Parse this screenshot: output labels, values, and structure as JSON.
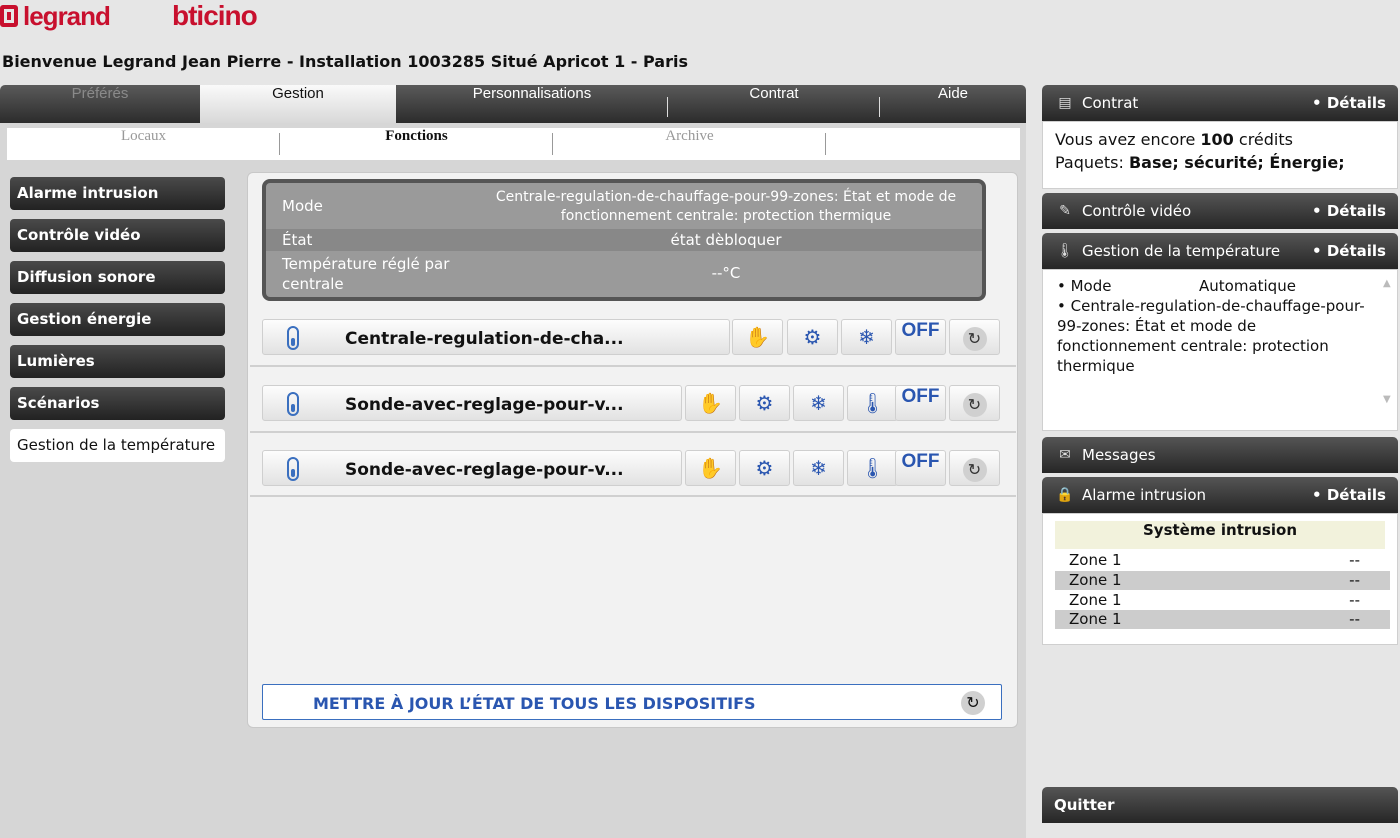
{
  "brand": {
    "legrand": "legrand",
    "bticino": "bticino"
  },
  "welcome": "Bienvenue Legrand Jean Pierre - Installation 1003285 Situé Apricot 1 - Paris",
  "main_tabs": [
    "Préférés",
    "Gestion",
    "Personnalisations",
    "Contrat",
    "Aide"
  ],
  "sub_tabs": [
    "Locaux",
    "Fonctions",
    "Archive"
  ],
  "sidebar": [
    "Alarme intrusion",
    "Contrôle vidéo",
    "Diffusion sonore",
    "Gestion énergie",
    "Lumières",
    "Scénarios",
    "Gestion de la température"
  ],
  "status": {
    "mode_label": "Mode",
    "mode_value": "Centrale-regulation-de-chauffage-pour-99-zones: État et mode de fonctionnement centrale: protection thermique",
    "state_label": "État",
    "state_value": "état dèbloquer",
    "temp_label": "Température réglé par centrale",
    "temp_value": "--°C"
  },
  "devices": [
    {
      "name": "Centrale-regulation-de-cha...",
      "off": "OFF"
    },
    {
      "name": "Sonde-avec-reglage-pour-v...",
      "off": "OFF"
    },
    {
      "name": "Sonde-avec-reglage-pour-v...",
      "off": "OFF"
    }
  ],
  "update_button": "METTRE À JOUR L’ÉTAT DE TOUS LES DISPOSITIFS",
  "details_label": "• Détails",
  "contract": {
    "title": "Contrat",
    "line1_pre": "Vous avez encore",
    "credits": "100",
    "line1_post": "crédits",
    "line2_pre": "Paquets:",
    "packages": "Base; sécurité; Énergie;"
  },
  "video": {
    "title": "Contrôle vidéo"
  },
  "temperature": {
    "title": "Gestion de la température",
    "mode_label": "• Mode",
    "mode_value": "Automatique",
    "detail": "• Centrale-regulation-de-chauffage-pour-99-zones: État et mode de fonctionnement centrale: protection thermique"
  },
  "messages": {
    "title": "Messages"
  },
  "alarm": {
    "title": "Alarme intrusion",
    "system_header": "Système intrusion",
    "zones": [
      {
        "name": "Zone 1",
        "value": "--"
      },
      {
        "name": "Zone 1",
        "value": "--"
      },
      {
        "name": "Zone 1",
        "value": "--"
      },
      {
        "name": "Zone 1",
        "value": "--"
      }
    ]
  },
  "quit": "Quitter",
  "colors": {
    "legrand_red": "#c8102e",
    "accent_blue": "#2a56b0",
    "dark_bar": "#2c2c2c"
  },
  "icons": [
    "thermometer-icon",
    "hand-icon",
    "gears-icon",
    "snowflake-icon",
    "thermostat-icon",
    "refresh-icon",
    "document-icon",
    "video-icon",
    "envelope-icon",
    "lock-icon"
  ]
}
